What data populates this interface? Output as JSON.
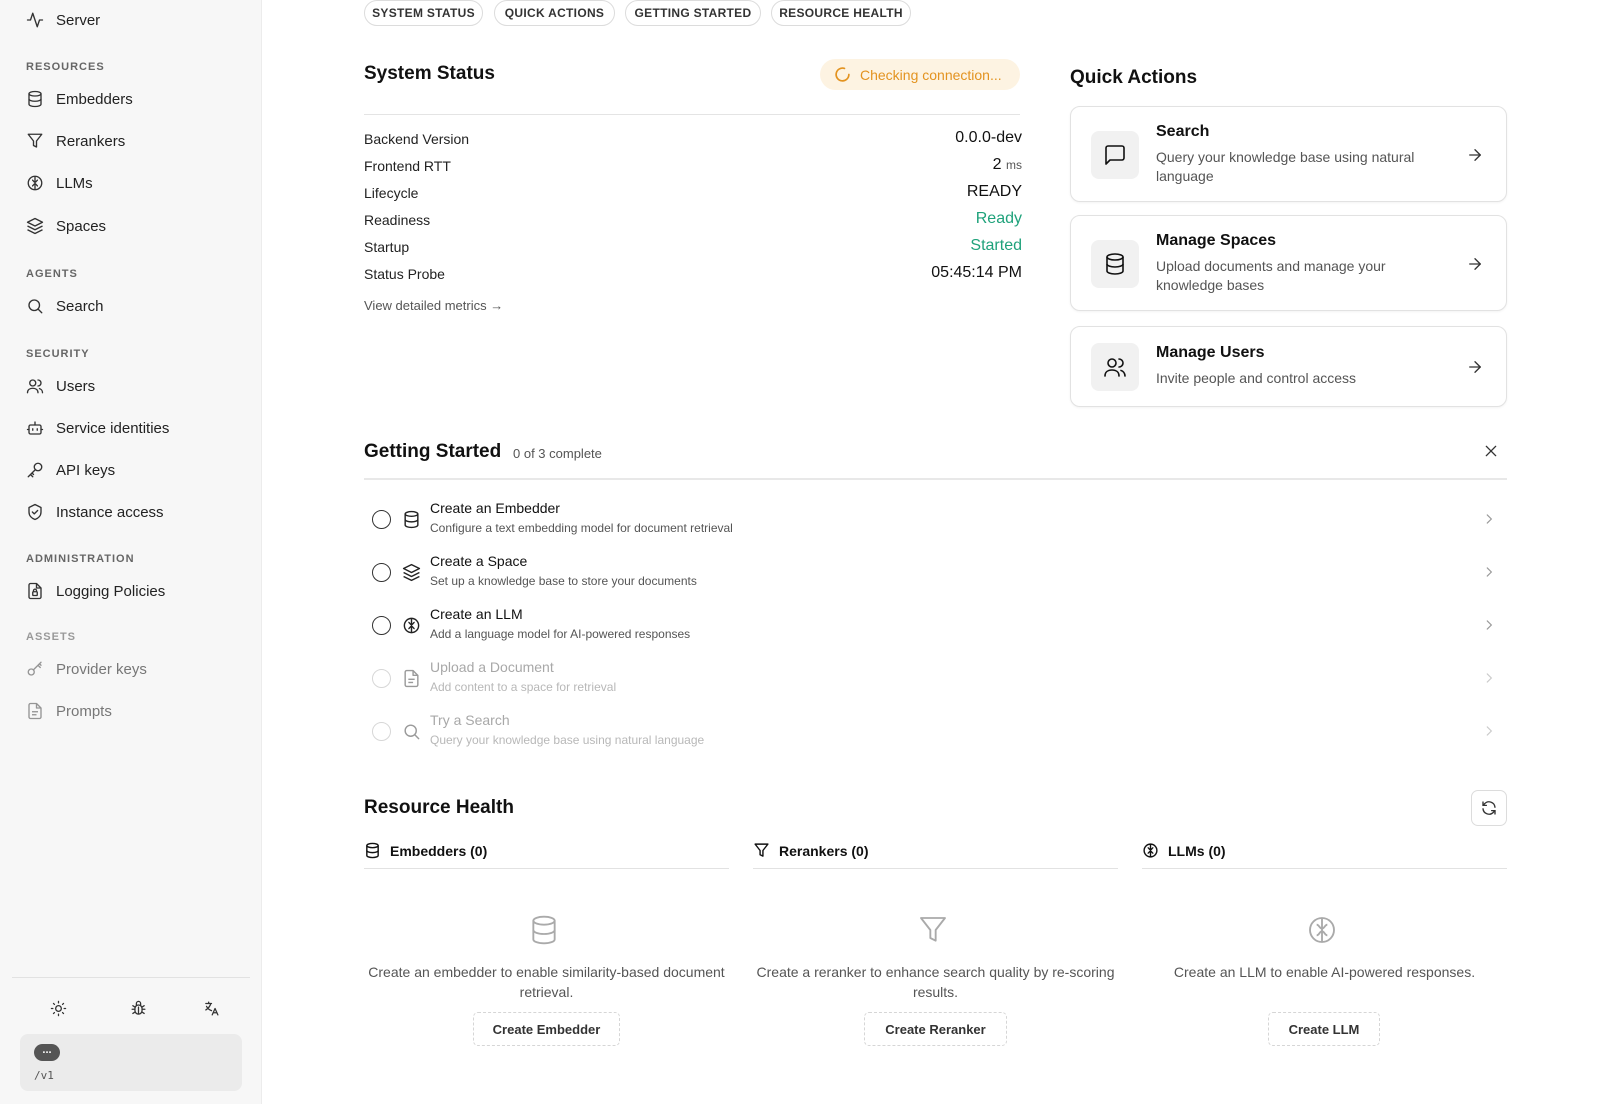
{
  "sidebar": {
    "server_label": "Server",
    "sections": {
      "resources": "RESOURCES",
      "agents": "AGENTS",
      "security": "SECURITY",
      "administration": "ADMINISTRATION",
      "assets": "ASSETS"
    },
    "items": {
      "embedders": "Embedders",
      "rerankers": "Rerankers",
      "llms": "LLMs",
      "spaces": "Spaces",
      "search": "Search",
      "users": "Users",
      "service_identities": "Service identities",
      "api_keys": "API keys",
      "instance_access": "Instance access",
      "logging_policies": "Logging Policies",
      "provider_keys": "Provider keys",
      "prompts": "Prompts"
    },
    "tools": [
      "sun-icon",
      "bug-icon",
      "translate-icon"
    ],
    "server_box": {
      "pill": "...",
      "path": "/v1"
    }
  },
  "chips": {
    "system_status": "SYSTEM STATUS",
    "quick_actions": "QUICK ACTIONS",
    "getting_started": "GETTING STARTED",
    "resource_health": "RESOURCE HEALTH"
  },
  "system_status": {
    "title": "System Status",
    "badge": "Checking connection...",
    "rows": {
      "backend_version": {
        "label": "Backend Version",
        "value": "0.0.0-dev"
      },
      "frontend_rtt": {
        "label": "Frontend RTT",
        "value": "2",
        "unit": "ms"
      },
      "lifecycle": {
        "label": "Lifecycle",
        "value": "READY"
      },
      "readiness": {
        "label": "Readiness",
        "value": "Ready"
      },
      "startup": {
        "label": "Startup",
        "value": "Started"
      },
      "status_probe": {
        "label": "Status Probe",
        "value": "05:45:14 PM"
      }
    },
    "metrics_link": "View detailed metrics →",
    "colors": {
      "badge_bg": "#fdf3e2",
      "badge_fg": "#e39320",
      "ok": "#1fa27b"
    }
  },
  "quick_actions": {
    "title": "Quick Actions",
    "search": {
      "title": "Search",
      "desc": "Query your knowledge base using natural language"
    },
    "spaces": {
      "title": "Manage Spaces",
      "desc": "Upload documents and manage your knowledge bases"
    },
    "users": {
      "title": "Manage Users",
      "desc": "Invite people and control access"
    }
  },
  "getting_started": {
    "title": "Getting Started",
    "count": "0 of 3 complete",
    "steps": {
      "embedder": {
        "title": "Create an Embedder",
        "desc": "Configure a text embedding model for document retrieval"
      },
      "space": {
        "title": "Create a Space",
        "desc": "Set up a knowledge base to store your documents"
      },
      "llm": {
        "title": "Create an LLM",
        "desc": "Add a language model for AI-powered responses"
      },
      "document": {
        "title": "Upload a Document",
        "desc": "Add content to a space for retrieval"
      },
      "search": {
        "title": "Try a Search",
        "desc": "Query your knowledge base using natural language"
      }
    }
  },
  "resource_health": {
    "title": "Resource Health",
    "embedders": {
      "head": "Embedders (0)",
      "text": "Create an embedder to enable similarity-based document retrieval.",
      "button": "Create Embedder"
    },
    "rerankers": {
      "head": "Rerankers (0)",
      "text": "Create a reranker to enhance search quality by re-scoring results.",
      "button": "Create Reranker"
    },
    "llms": {
      "head": "LLMs (0)",
      "text": "Create an LLM to enable AI-powered responses.",
      "button": "Create LLM"
    }
  }
}
